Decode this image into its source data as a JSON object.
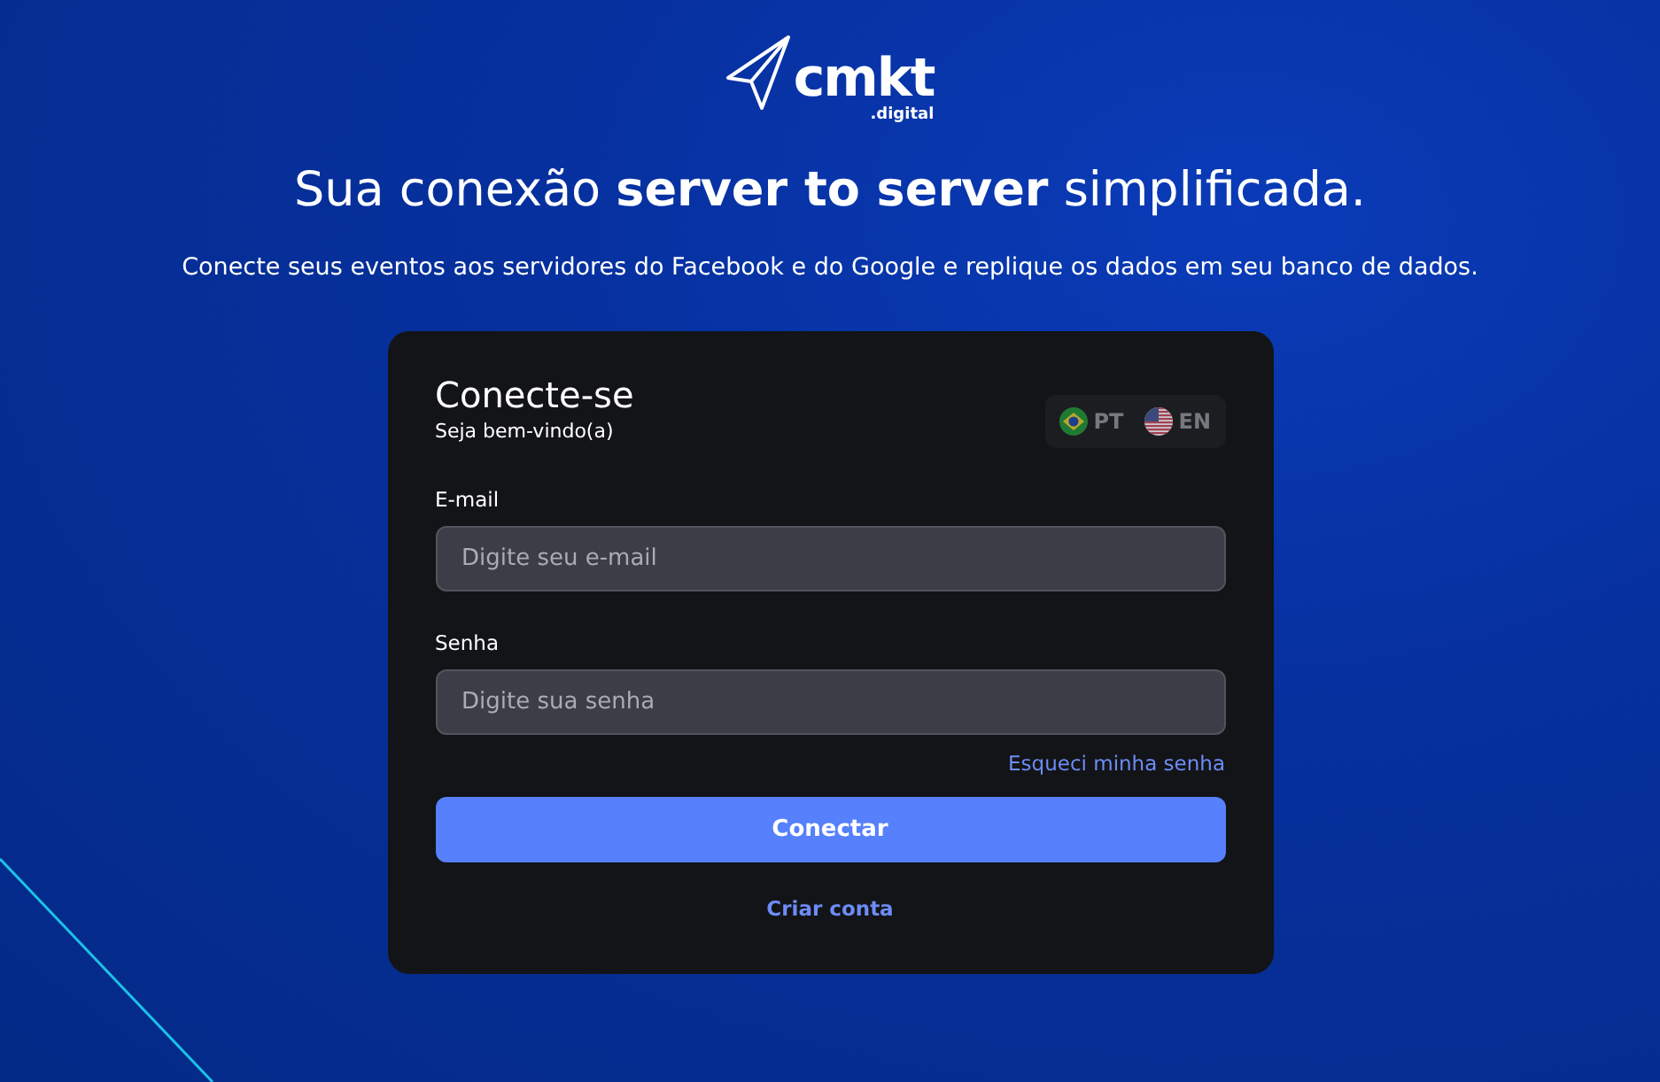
{
  "logo": {
    "name": "cmkt",
    "suffix": ".digital"
  },
  "headline": "Sua conexão **server to server** simplificada.",
  "subtitle": "Conecte seus eventos aos servidores do Facebook e do Google e replique os dados em seu banco de dados.",
  "card": {
    "title": "Conecte-se",
    "subtitle": "Seja bem-vindo(a)",
    "languages": [
      {
        "label": "PT",
        "kind": "brazil"
      },
      {
        "label": "EN",
        "kind": "usa"
      }
    ],
    "fields": [
      {
        "label": "E-mail",
        "placeholder": "Digite seu e-mail"
      },
      {
        "label": "Senha",
        "placeholder": "Digite sua senha"
      }
    ],
    "forgot_link": "Esqueci minha senha",
    "submit_button": "Conectar",
    "create_link": "Criar conta"
  }
}
